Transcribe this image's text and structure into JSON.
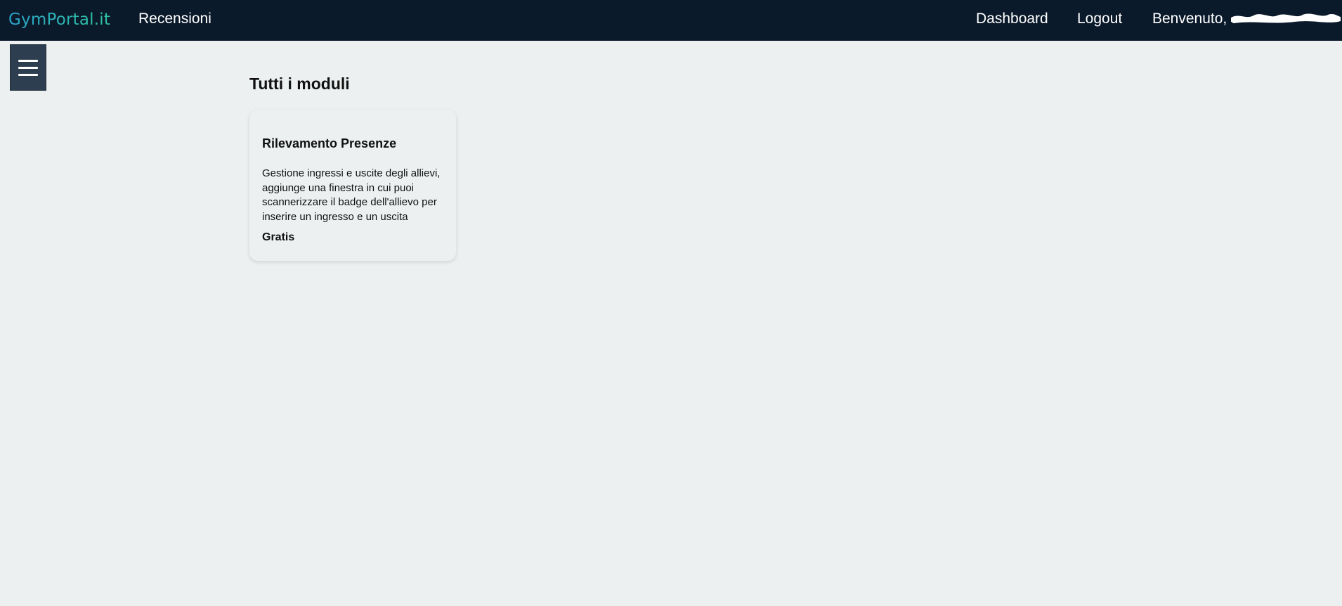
{
  "navbar": {
    "brand": "GymPortal.it",
    "links": {
      "reviews": "Recensioni",
      "dashboard": "Dashboard",
      "logout": "Logout"
    },
    "welcome_prefix": "Benvenuto,"
  },
  "sidebar_toggle": {
    "icon": "hamburger-menu-icon"
  },
  "main": {
    "section_title": "Tutti i moduli",
    "modules": [
      {
        "title": "Rilevamento Presenze",
        "description": "Gestione ingressi e uscite degli allievi, aggiunge una finestra in cui puoi scannerizzare il badge dell'allievo per inserire un ingresso e un uscita",
        "price": "Gratis"
      }
    ]
  },
  "colors": {
    "navbar_bg": "#0b1a2b",
    "page_bg": "#ecf0f1",
    "toggle_bg": "#2c3e50",
    "brand_gradient_start": "#2aa4c9",
    "brand_gradient_end": "#2fc3a0"
  }
}
